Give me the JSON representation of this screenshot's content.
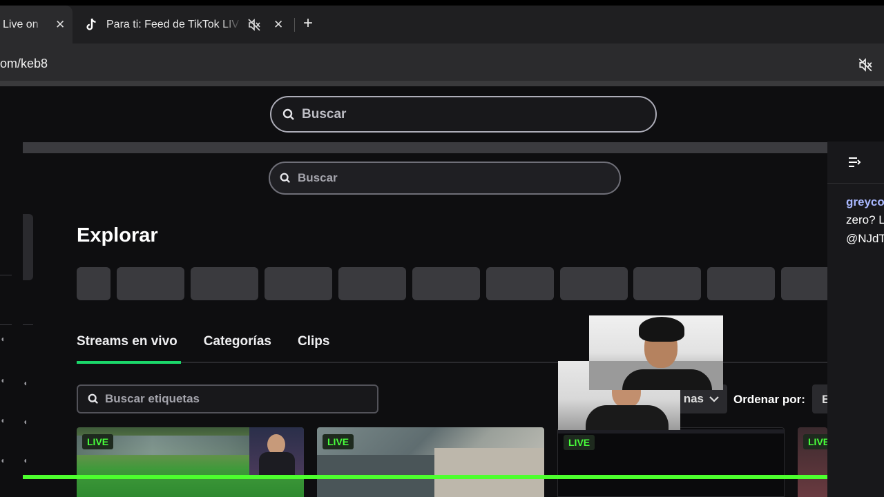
{
  "browser": {
    "tabs": [
      {
        "label": "Live on",
        "close": "✕"
      },
      {
        "label": "Para ti: Feed de TikTok LIV",
        "close": "✕"
      }
    ],
    "new_tab": "+",
    "url": "om/keb8"
  },
  "page": {
    "search_top_placeholder": "Buscar",
    "search_inner_placeholder": "Buscar",
    "title": "Explorar",
    "tabs": [
      "Streams en vivo",
      "Categorías",
      "Clips"
    ],
    "tag_search_placeholder": "Buscar etiquetas",
    "language_fragment": "nas",
    "sort_label": "Ordenar por:",
    "sort_value_fragment": "E",
    "live_badge": "LIVE"
  },
  "chat": {
    "username": "greyco",
    "line1": "zero? L",
    "line2": "@NJdT"
  },
  "colors": {
    "accent_green": "#1bd76a",
    "live_green": "#48ff3b",
    "chat_username": "#a9b8ff"
  }
}
